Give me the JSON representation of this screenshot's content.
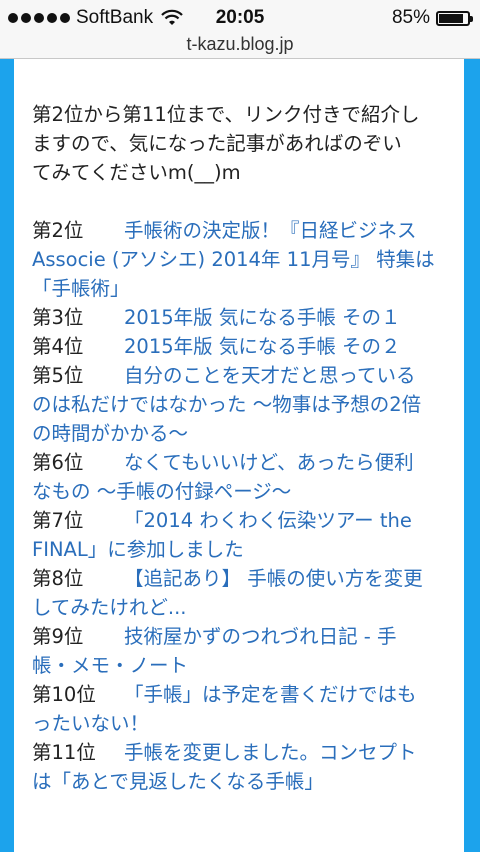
{
  "status": {
    "carrier": "SoftBank",
    "time": "20:05",
    "battery": "85%",
    "battery_level": 0.85,
    "signal_icon": "signal-dots-icon",
    "wifi_icon": "wifi-icon",
    "battery_icon": "battery-icon"
  },
  "browser": {
    "url": "t-kazu.blog.jp"
  },
  "colors": {
    "sidebar": "#1ca3ec",
    "link": "#2a6ebb",
    "text": "#222222"
  },
  "intro": {
    "line1": "第2位から第11位まで、リンク付きで紹介し",
    "line2": "ますので、気になった記事があればのぞい",
    "line3": "てみてくださいm(__)m"
  },
  "rankings": [
    {
      "rank": "第2位",
      "lines": [
        "手帳術の決定版！『日経ビジネス",
        "Associe (アソシエ) 2014年 11月号』 特集は",
        "「手帳術」"
      ]
    },
    {
      "rank": "第3位",
      "lines": [
        "2015年版 気になる手帳 その１"
      ]
    },
    {
      "rank": "第4位",
      "lines": [
        "2015年版 気になる手帳 その２"
      ]
    },
    {
      "rank": "第5位",
      "lines": [
        "自分のことを天才だと思っている",
        "のは私だけではなかった 〜物事は予想の2倍",
        "の時間がかかる〜"
      ]
    },
    {
      "rank": "第6位",
      "lines": [
        "なくてもいいけど、あったら便利",
        "なもの 〜手帳の付録ページ〜"
      ]
    },
    {
      "rank": "第7位",
      "lines": [
        "「2014 わくわく伝染ツアー the",
        "FINAL」に参加しました"
      ]
    },
    {
      "rank": "第8位",
      "lines": [
        "【追記あり】 手帳の使い方を変更",
        "してみたけれど..."
      ]
    },
    {
      "rank": "第9位",
      "lines": [
        "技術屋かずのつれづれ日記 - 手",
        "帳・メモ・ノート"
      ]
    },
    {
      "rank": "第10位",
      "lines": [
        "「手帳」は予定を書くだけではも",
        "ったいない！"
      ]
    },
    {
      "rank": "第11位",
      "lines": [
        "手帳を変更しました。コンセプト",
        "は「あとで見返したくなる手帳」"
      ]
    }
  ]
}
